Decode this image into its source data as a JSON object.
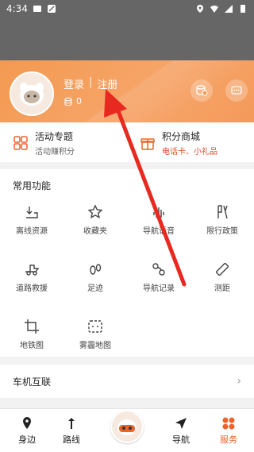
{
  "status": {
    "time": "4:34"
  },
  "profile": {
    "login": "登录",
    "separator": "|",
    "register": "注册",
    "coins": "0"
  },
  "promos": [
    {
      "title": "活动专题",
      "subtitle": "活动赚积分",
      "icon": "grid-icon"
    },
    {
      "title": "积分商城",
      "subtitle": "电话卡、小礼品",
      "icon": "gift-icon"
    }
  ],
  "features": {
    "title": "常用功能",
    "items": [
      {
        "label": "离线资源",
        "icon": "download-map-icon"
      },
      {
        "label": "收藏夹",
        "icon": "star-icon"
      },
      {
        "label": "导航语音",
        "icon": "voice-icon"
      },
      {
        "label": "限行政策",
        "icon": "restriction-icon"
      },
      {
        "label": "道路救援",
        "icon": "rescue-icon"
      },
      {
        "label": "足迹",
        "icon": "footprint-icon"
      },
      {
        "label": "导航记录",
        "icon": "nav-record-icon"
      },
      {
        "label": "测距",
        "icon": "ruler-icon"
      },
      {
        "label": "地铁图",
        "icon": "crop-icon"
      },
      {
        "label": "雾霾地图",
        "icon": "haze-map-icon"
      }
    ]
  },
  "carlink": {
    "label": "车机互联"
  },
  "tabs": [
    {
      "label": "身边",
      "icon": "location-pin-icon"
    },
    {
      "label": "路线",
      "icon": "route-icon"
    },
    {
      "label": "导航",
      "icon": "navigation-arrow-icon"
    },
    {
      "label": "服务",
      "icon": "service-icon"
    }
  ],
  "colors": {
    "accent": "#e8662a",
    "header": "#f39a51",
    "annotation_arrow": "#e8291f"
  }
}
